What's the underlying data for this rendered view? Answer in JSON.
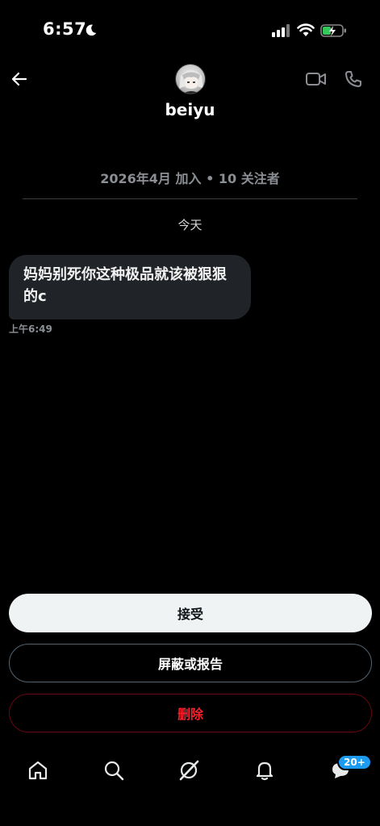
{
  "status_bar": {
    "time": "6:57"
  },
  "header": {
    "username": "beiyu"
  },
  "profile_info": {
    "joined": "2026年4月 加入 • 10 关注者"
  },
  "conversation": {
    "day_label": "今天",
    "messages": [
      {
        "text": "妈妈别死你这种极品就该被狠狠的c",
        "time": "上午6:49"
      }
    ]
  },
  "actions": {
    "accept": "接受",
    "block_report": "屏蔽或报告",
    "delete": "删除"
  },
  "nav": {
    "messages_badge": "20+"
  },
  "colors": {
    "background": "#000000",
    "bubble": "#202327",
    "accent": "#1d9bf0",
    "danger": "#f4212e",
    "muted": "#8b8f94"
  }
}
